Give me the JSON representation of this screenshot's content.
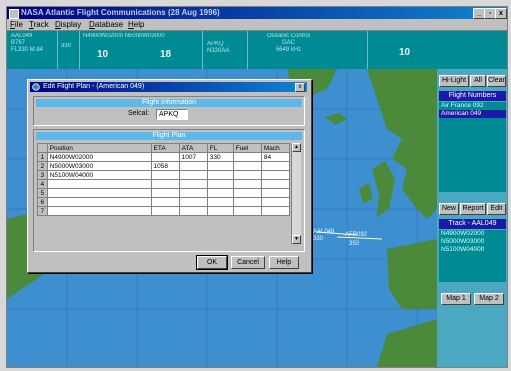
{
  "app": {
    "title": "NASA Atlantic Flight Communications (28 Aug 1996)",
    "window_buttons": [
      "_",
      "▫",
      "x"
    ]
  },
  "menu": [
    "File",
    "Track",
    "Display",
    "Database",
    "Help"
  ],
  "status": {
    "c1": "AAL049\nB767\nFL330 M.84",
    "c2": "330",
    "c3": "N4900W02000 N5000W03000",
    "c3b": "10",
    "c4": "18",
    "c5": "APKQ\nN330AA",
    "c6": "Oceanic Control\nGAC\n5649 kHz",
    "c7": "10"
  },
  "map": {
    "track_labels": [
      "AAL049",
      "330",
      "AFR092",
      "350"
    ]
  },
  "right_panel": {
    "top_buttons": [
      "Hi-Light",
      "All",
      "Clear"
    ],
    "flight_numbers_header": "Flight Numbers",
    "flights": [
      "Air France 092",
      "American 049"
    ],
    "selected_flight": "American 049",
    "mid_buttons": [
      "New",
      "Report",
      "Edit"
    ],
    "track_header": "Track - AAL049",
    "track_items": [
      "N4900W02000",
      "N5000W03000",
      "N5100W04000"
    ],
    "map_buttons": [
      "Map 1",
      "Map 2"
    ]
  },
  "dialog": {
    "title": "Edit Flight Plan - (American 049)",
    "info_header": "Flight Information",
    "selcal_label": "Selcal:",
    "selcal_value": "APKQ",
    "plan_header": "Flight Plan",
    "columns": [
      "Position",
      "ETA",
      "ATA",
      "FL",
      "Fuel",
      "Mach"
    ],
    "rows": [
      [
        "1",
        "N4900W02000",
        "",
        "1007",
        "330",
        "",
        "84"
      ],
      [
        "2",
        "N5000W03000",
        "1058",
        "",
        "",
        "",
        ""
      ],
      [
        "3",
        "N5100W04000",
        "",
        "",
        "",
        "",
        ""
      ],
      [
        "4",
        "",
        "",
        "",
        "",
        "",
        ""
      ],
      [
        "5",
        "",
        "",
        "",
        "",
        "",
        ""
      ],
      [
        "6",
        "",
        "",
        "",
        "",
        "",
        ""
      ],
      [
        "7",
        "",
        "",
        "",
        "",
        "",
        ""
      ]
    ],
    "buttons": [
      "OK",
      "Cancel",
      "Help"
    ]
  },
  "colors": {
    "map_ocean": "#3d8fd0",
    "land": "#4a8a3a",
    "status_bar": "#008b94",
    "title_bar": "#000080",
    "list_selection": "#1a1aa8"
  }
}
